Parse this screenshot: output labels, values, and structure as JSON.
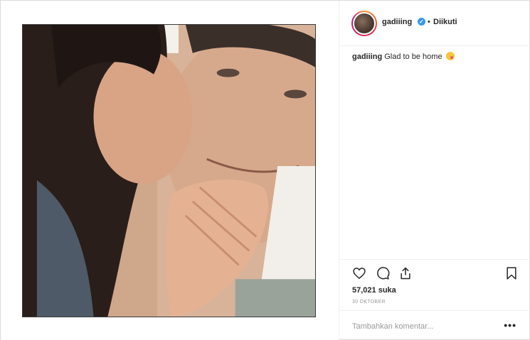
{
  "post": {
    "username": "gadiiing",
    "verified_icon": "verified-badge-icon",
    "follow_separator": "•",
    "follow_state": "Diikuti",
    "caption_user": "gadiiing",
    "caption_text": "Glad to be home",
    "caption_emoji": "kissing-face-emoji",
    "likes": "57,021 suka",
    "date": "30 OKTOBER",
    "comment_placeholder": "Tambahkan komentar...",
    "more_label": "•••"
  },
  "icons": {
    "like": "heart-icon",
    "comment": "comment-bubble-icon",
    "share": "share-icon",
    "save": "bookmark-icon"
  },
  "colors": {
    "accent": "#3897f0",
    "text": "#262626",
    "muted": "#999999",
    "border": "#efefef"
  }
}
